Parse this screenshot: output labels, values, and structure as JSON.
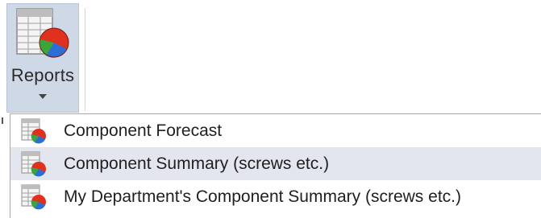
{
  "ribbon": {
    "reports_button": {
      "label": "Reports",
      "icon": "report-spreadsheet-pie-icon",
      "caret_icon": "caret-down-icon"
    }
  },
  "menu": {
    "items": [
      {
        "label": "Component Forecast",
        "icon": "report-spreadsheet-pie-icon",
        "highlighted": false
      },
      {
        "label": "Component Summary (screws etc.)",
        "icon": "report-spreadsheet-pie-icon",
        "highlighted": true
      },
      {
        "label": "My Department's Component Summary (screws etc.)",
        "icon": "report-spreadsheet-pie-icon",
        "highlighted": false
      }
    ]
  },
  "colors": {
    "button_pressed": "#cfd8e6",
    "menu_hover": "#e3e6ee",
    "pie_red": "#e0301e",
    "pie_green": "#3aa53a",
    "pie_blue": "#2a6fd6"
  }
}
